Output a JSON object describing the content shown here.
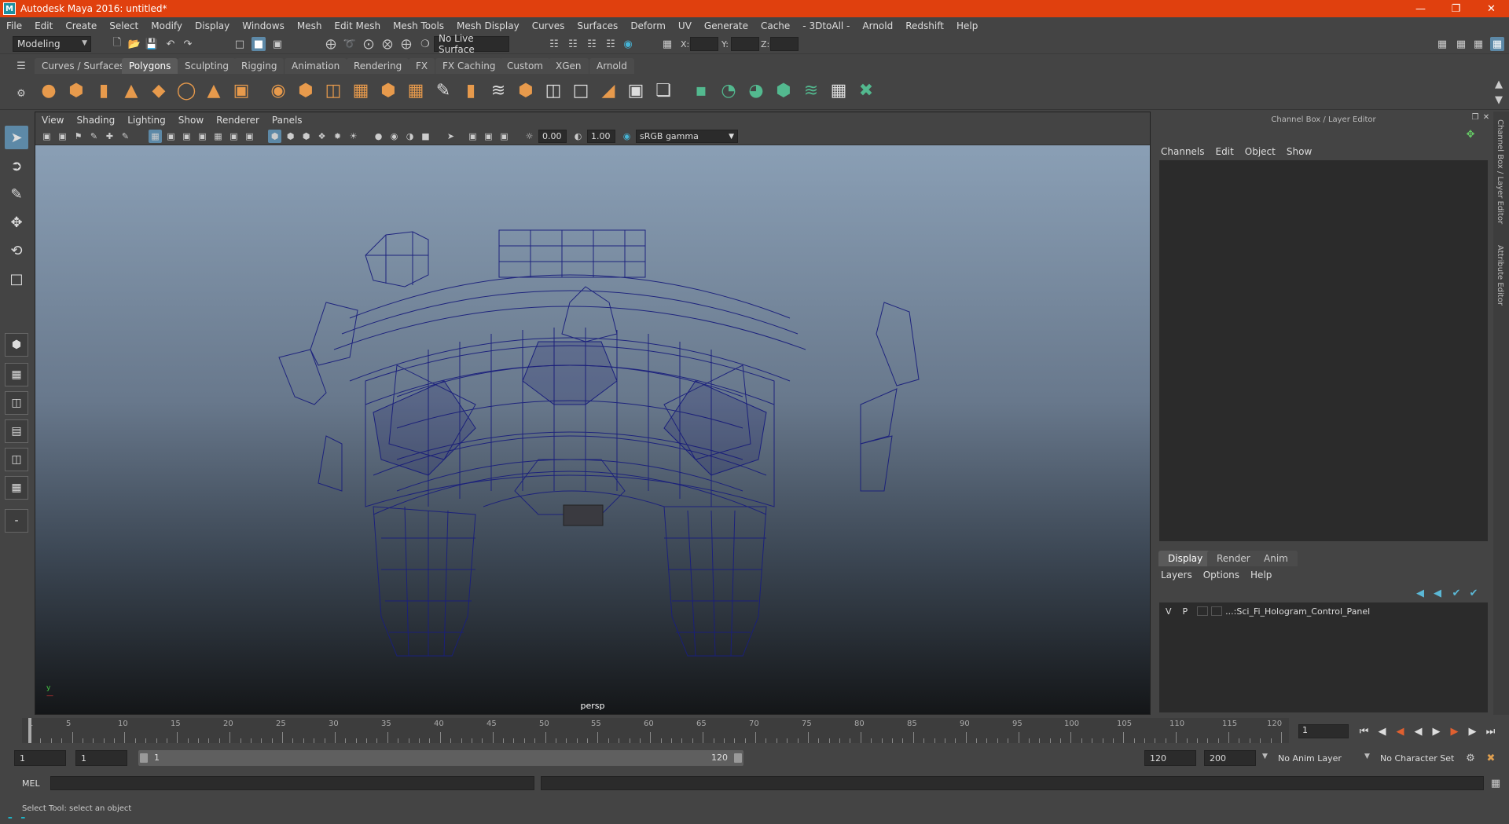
{
  "titlebar": {
    "title": "Autodesk Maya 2016: untitled*"
  },
  "menus": [
    "File",
    "Edit",
    "Create",
    "Select",
    "Modify",
    "Display",
    "Windows",
    "Mesh",
    "Edit Mesh",
    "Mesh Tools",
    "Mesh Display",
    "Curves",
    "Surfaces",
    "Deform",
    "UV",
    "Generate",
    "Cache",
    "- 3DtoAll -",
    "Arnold",
    "Redshift",
    "Help"
  ],
  "status": {
    "mode": "Modeling",
    "live_surface": "No Live Surface",
    "x_label": "X:",
    "y_label": "Y:",
    "z_label": "Z:"
  },
  "shelf_tabs": [
    "Curves / Surfaces",
    "Polygons",
    "Sculpting",
    "Rigging",
    "Animation",
    "Rendering",
    "FX",
    "FX Caching",
    "Custom",
    "XGen",
    "Arnold"
  ],
  "active_shelf": "Polygons",
  "viewport": {
    "menus": [
      "View",
      "Shading",
      "Lighting",
      "Show",
      "Renderer",
      "Panels"
    ],
    "exposure": "0.00",
    "gamma": "1.00",
    "colorspace": "sRGB gamma",
    "camera": "persp"
  },
  "channel_box": {
    "title": "Channel Box / Layer Editor",
    "menus": [
      "Channels",
      "Edit",
      "Object",
      "Show"
    ],
    "layer_tabs": [
      "Display",
      "Render",
      "Anim"
    ],
    "layer_menus": [
      "Layers",
      "Options",
      "Help"
    ],
    "layer": {
      "v": "V",
      "p": "P",
      "name": "...:Sci_Fi_Hologram_Control_Panel"
    },
    "side_tabs": [
      "Channel Box / Layer Editor",
      "Attribute Editor"
    ]
  },
  "timeline": {
    "ticks": [
      "1",
      "5",
      "10",
      "15",
      "20",
      "25",
      "30",
      "35",
      "40",
      "45",
      "50",
      "55",
      "60",
      "65",
      "70",
      "75",
      "80",
      "85",
      "90",
      "95",
      "100",
      "105",
      "110",
      "115",
      "120"
    ],
    "current_frame": "1"
  },
  "range": {
    "start": "1",
    "playback_start": "1",
    "slider_start": "1",
    "slider_end": "120",
    "playback_end": "120",
    "end": "200",
    "anim_layer": "No Anim Layer",
    "character_set": "No Character Set"
  },
  "mel": {
    "label": "MEL"
  },
  "help_line": "Select Tool: select an object"
}
